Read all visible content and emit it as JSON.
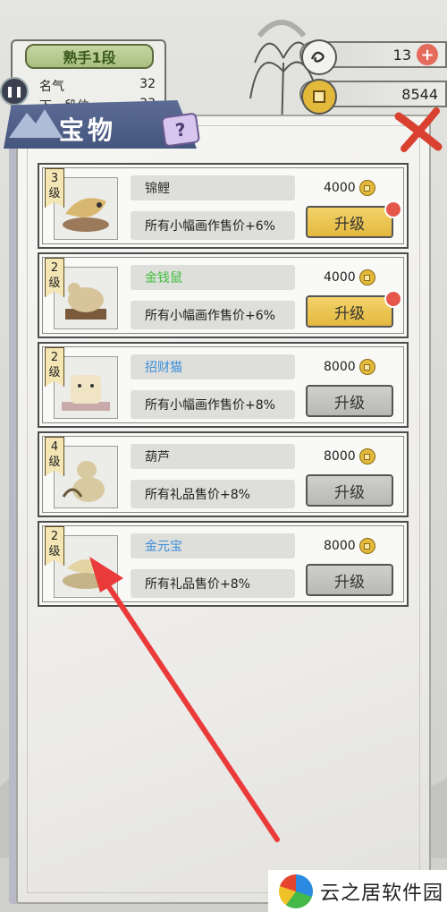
{
  "hud": {
    "rank_title": "熟手1段",
    "fame_label": "名气",
    "fame_value": "32",
    "next_rank_label": "下一段位",
    "next_rank_value": "33",
    "currency1_value": "13",
    "currency2_value": "8544"
  },
  "panel": {
    "title": "宝物",
    "help_label": "?"
  },
  "treasures": [
    {
      "level_num": "3",
      "level_unit": "级",
      "name": "锦鲤",
      "name_color": "#333333",
      "desc": "所有小幅画作售价+6%",
      "cost": "4000",
      "button": "升级",
      "active": true
    },
    {
      "level_num": "2",
      "level_unit": "级",
      "name": "金钱鼠",
      "name_color": "#3fbf3a",
      "desc": "所有小幅画作售价+6%",
      "cost": "4000",
      "button": "升级",
      "active": true
    },
    {
      "level_num": "2",
      "level_unit": "级",
      "name": "招财猫",
      "name_color": "#3b8ed8",
      "desc": "所有小幅画作售价+8%",
      "cost": "8000",
      "button": "升级",
      "active": false
    },
    {
      "level_num": "4",
      "level_unit": "级",
      "name": "葫芦",
      "name_color": "#333333",
      "desc": "所有礼品售价+8%",
      "cost": "8000",
      "button": "升级",
      "active": false
    },
    {
      "level_num": "2",
      "level_unit": "级",
      "name": "金元宝",
      "name_color": "#3b8ed8",
      "desc": "所有礼品售价+8%",
      "cost": "8000",
      "button": "升级",
      "active": false
    }
  ],
  "watermark": {
    "text": "云之居软件园"
  },
  "colors": {
    "accent_gold": "#e4b83f",
    "title_tab": "#4d5e87",
    "annotation_arrow": "#ea3a3a"
  }
}
